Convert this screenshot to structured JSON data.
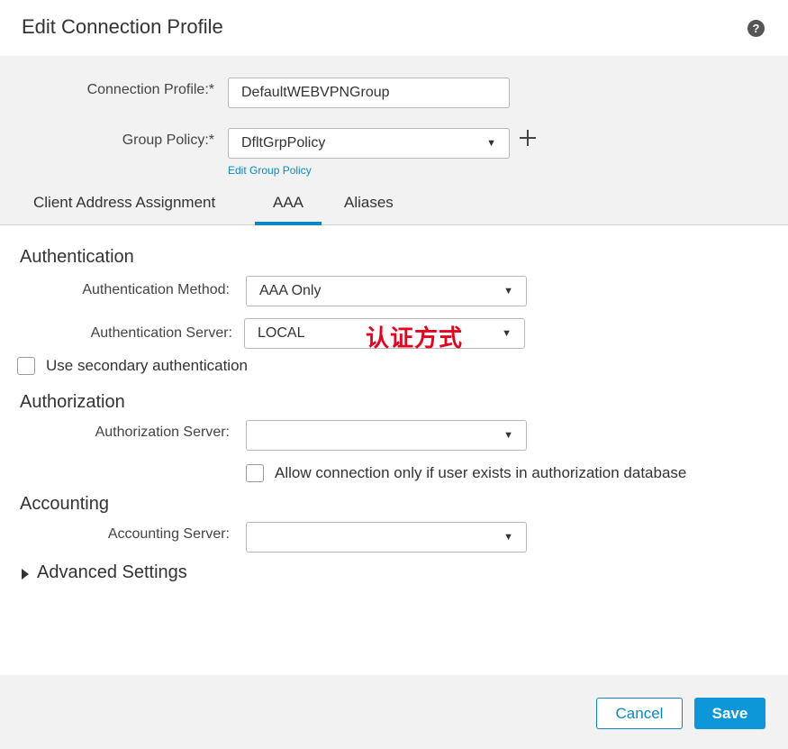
{
  "dialog": {
    "title": "Edit Connection Profile",
    "help_icon": "question-circle-icon"
  },
  "form": {
    "connection_profile_label": "Connection Profile:*",
    "connection_profile_value": "DefaultWEBVPNGroup",
    "group_policy_label": "Group Policy:*",
    "group_policy_value": "DfltGrpPolicy",
    "edit_group_policy_link": "Edit Group Policy",
    "add_icon": "plus-icon"
  },
  "tabs": [
    {
      "label": "Client Address Assignment",
      "active": false
    },
    {
      "label": "AAA",
      "active": true
    },
    {
      "label": "Aliases",
      "active": false
    }
  ],
  "authentication": {
    "title": "Authentication",
    "method_label": "Authentication Method:",
    "method_value": "AAA Only",
    "server_label": "Authentication Server:",
    "server_value": "LOCAL",
    "annotation": "认证方式",
    "secondary_label": "Use secondary authentication"
  },
  "authorization": {
    "title": "Authorization",
    "server_label": "Authorization Server:",
    "server_value": "",
    "allow_label": "Allow connection only if user exists in authorization database"
  },
  "accounting": {
    "title": "Accounting",
    "server_label": "Accounting Server:",
    "server_value": ""
  },
  "advanced": {
    "label": "Advanced Settings"
  },
  "footer": {
    "cancel_label": "Cancel",
    "save_label": "Save"
  },
  "colors": {
    "accent": "#0d86c4",
    "save_bg": "#0d96d8",
    "annotation": "#e8001c"
  }
}
